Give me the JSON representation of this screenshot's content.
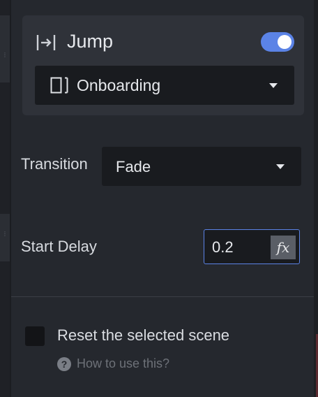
{
  "jump": {
    "title": "Jump",
    "enabled": true,
    "icon": "jump-icon",
    "scene_select": {
      "value": "Onboarding",
      "icon": "scene-frame-icon"
    }
  },
  "transition": {
    "label": "Transition",
    "value": "Fade"
  },
  "start_delay": {
    "label": "Start Delay",
    "value": "0.2",
    "fx_label": "fx"
  },
  "reset": {
    "label": "Reset the selected scene",
    "checked": false
  },
  "help": {
    "icon_glyph": "?",
    "link_text": "How to use this?"
  },
  "colors": {
    "accent": "#5b83e6",
    "panel": "#25282e",
    "card": "#2f3239",
    "field": "#191b1f"
  }
}
